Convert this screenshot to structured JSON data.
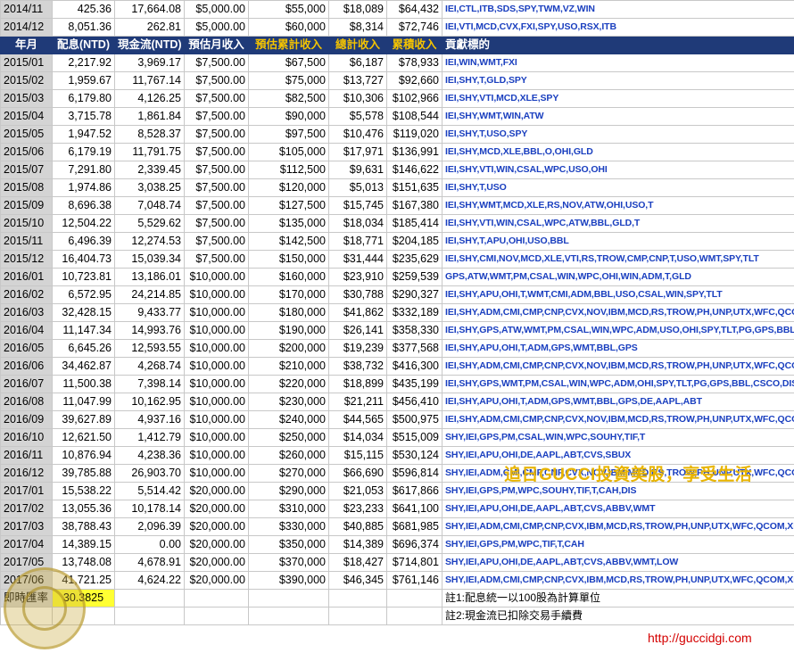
{
  "header": {
    "col_month": "年月",
    "col_dividend": "配息(NTD)",
    "col_cashflow": "現金流(NTD)",
    "col_est_monthly": "預估月收入",
    "col_est_cumulative": "預估累計收入",
    "col_total": "總計收入",
    "col_accum": "累積收入",
    "col_contrib": "貢獻標的"
  },
  "top_rows": [
    {
      "month": "2014/11",
      "dividend": "425.36",
      "cashflow": "17,664.08",
      "est_monthly": "$5,000.00",
      "est_cum": "$55,000",
      "total": "$18,089",
      "accum": "$64,432",
      "stocks": "IEI,CTL,ITB,SDS,SPY,TWM,VZ,WIN"
    },
    {
      "month": "2014/12",
      "dividend": "8,051.36",
      "cashflow": "262.81",
      "est_monthly": "$5,000.00",
      "est_cum": "$60,000",
      "total": "$8,314",
      "accum": "$72,746",
      "stocks": "IEI,VTI,MCD,CVX,FXI,SPY,USO,RSX,ITB"
    }
  ],
  "rows": [
    {
      "month": "2015/01",
      "dividend": "2,217.92",
      "cashflow": "3,969.17",
      "est_monthly": "$7,500.00",
      "est_cum": "$67,500",
      "total": "$6,187",
      "accum": "$78,933",
      "stocks": "IEI,WIN,WMT,FXI"
    },
    {
      "month": "2015/02",
      "dividend": "1,959.67",
      "cashflow": "11,767.14",
      "est_monthly": "$7,500.00",
      "est_cum": "$75,000",
      "total": "$13,727",
      "accum": "$92,660",
      "stocks": "IEI,SHY,T,GLD,SPY"
    },
    {
      "month": "2015/03",
      "dividend": "6,179.80",
      "cashflow": "4,126.25",
      "est_monthly": "$7,500.00",
      "est_cum": "$82,500",
      "total": "$10,306",
      "accum": "$102,966",
      "stocks": "IEI,SHY,VTI,MCD,XLE,SPY"
    },
    {
      "month": "2015/04",
      "dividend": "3,715.78",
      "cashflow": "1,861.84",
      "est_monthly": "$7,500.00",
      "est_cum": "$90,000",
      "total": "$5,578",
      "accum": "$108,544",
      "stocks": "IEI,SHY,WMT,WIN,ATW"
    },
    {
      "month": "2015/05",
      "dividend": "1,947.52",
      "cashflow": "8,528.37",
      "est_monthly": "$7,500.00",
      "est_cum": "$97,500",
      "total": "$10,476",
      "accum": "$119,020",
      "stocks": "IEI,SHY,T,USO,SPY"
    },
    {
      "month": "2015/06",
      "dividend": "6,179.19",
      "cashflow": "11,791.75",
      "est_monthly": "$7,500.00",
      "est_cum": "$105,000",
      "total": "$17,971",
      "accum": "$136,991",
      "stocks": "IEI,SHY,MCD,XLE,BBL,O,OHI,GLD"
    },
    {
      "month": "2015/07",
      "dividend": "7,291.80",
      "cashflow": "2,339.45",
      "est_monthly": "$7,500.00",
      "est_cum": "$112,500",
      "total": "$9,631",
      "accum": "$146,622",
      "stocks": "IEI,SHY,VTI,WIN,CSAL,WPC,USO,OHI"
    },
    {
      "month": "2015/08",
      "dividend": "1,974.86",
      "cashflow": "3,038.25",
      "est_monthly": "$7,500.00",
      "est_cum": "$120,000",
      "total": "$5,013",
      "accum": "$151,635",
      "stocks": "IEI,SHY,T,USO"
    },
    {
      "month": "2015/09",
      "dividend": "8,696.38",
      "cashflow": "7,048.74",
      "est_monthly": "$7,500.00",
      "est_cum": "$127,500",
      "total": "$15,745",
      "accum": "$167,380",
      "stocks": "IEI,SHY,WMT,MCD,XLE,RS,NOV,ATW,OHI,USO,T"
    },
    {
      "month": "2015/10",
      "dividend": "12,504.22",
      "cashflow": "5,529.62",
      "est_monthly": "$7,500.00",
      "est_cum": "$135,000",
      "total": "$18,034",
      "accum": "$185,414",
      "stocks": "IEI,SHY,VTI,WIN,CSAL,WPC,ATW,BBL,GLD,T"
    },
    {
      "month": "2015/11",
      "dividend": "6,496.39",
      "cashflow": "12,274.53",
      "est_monthly": "$7,500.00",
      "est_cum": "$142,500",
      "total": "$18,771",
      "accum": "$204,185",
      "stocks": "IEI,SHY,T,APU,OHI,USO,BBL"
    },
    {
      "month": "2015/12",
      "dividend": "16,404.73",
      "cashflow": "15,039.34",
      "est_monthly": "$7,500.00",
      "est_cum": "$150,000",
      "total": "$31,444",
      "accum": "$235,629",
      "stocks": "IEI,SHY,CMI,NOV,MCD,XLE,VTI,RS,TROW,CMP,CNP,T,USO,WMT,SPY,TLT"
    },
    {
      "month": "2016/01",
      "dividend": "10,723.81",
      "cashflow": "13,186.01",
      "est_monthly": "$10,000.00",
      "est_cum": "$160,000",
      "total": "$23,910",
      "accum": "$259,539",
      "stocks": "GPS,ATW,WMT,PM,CSAL,WIN,WPC,OHI,WIN,ADM,T,GLD"
    },
    {
      "month": "2016/02",
      "dividend": "6,572.95",
      "cashflow": "24,214.85",
      "est_monthly": "$10,000.00",
      "est_cum": "$170,000",
      "total": "$30,788",
      "accum": "$290,327",
      "stocks": "IEI,SHY,APU,OHI,T,WMT,CMI,ADM,BBL,USO,CSAL,WIN,SPY,TLT"
    },
    {
      "month": "2016/03",
      "dividend": "32,428.15",
      "cashflow": "9,433.77",
      "est_monthly": "$10,000.00",
      "est_cum": "$180,000",
      "total": "$41,862",
      "accum": "$332,189",
      "stocks": "IEI,SHY,ADM,CMI,CMP,CNP,CVX,NOV,IBM,MCD,RS,TROW,PH,UNP,UTX,WFC,QCOM"
    },
    {
      "month": "2016/04",
      "dividend": "11,147.34",
      "cashflow": "14,993.76",
      "est_monthly": "$10,000.00",
      "est_cum": "$190,000",
      "total": "$26,141",
      "accum": "$358,330",
      "stocks": "IEI,SHY,GPS,ATW,WMT,PM,CSAL,WIN,WPC,ADM,USO,OHI,SPY,TLT,PG,GPS,BBL"
    },
    {
      "month": "2016/05",
      "dividend": "6,645.26",
      "cashflow": "12,593.55",
      "est_monthly": "$10,000.00",
      "est_cum": "$200,000",
      "total": "$19,239",
      "accum": "$377,568",
      "stocks": "IEI,SHY,APU,OHI,T,ADM,GPS,WMT,BBL,GPS"
    },
    {
      "month": "2016/06",
      "dividend": "34,462.87",
      "cashflow": "4,268.74",
      "est_monthly": "$10,000.00",
      "est_cum": "$210,000",
      "total": "$38,732",
      "accum": "$416,300",
      "stocks": "IEI,SHY,ADM,CMI,CMP,CNP,CVX,NOV,IBM,MCD,RS,TROW,PH,UNP,UTX,WFC,QCOM"
    },
    {
      "month": "2016/07",
      "dividend": "11,500.38",
      "cashflow": "7,398.14",
      "est_monthly": "$10,000.00",
      "est_cum": "$220,000",
      "total": "$18,899",
      "accum": "$435,199",
      "stocks": "IEI,SHY,GPS,WMT,PM,CSAL,WIN,WPC,ADM,OHI,SPY,TLT,PG,GPS,BBL,CSCO,DIS"
    },
    {
      "month": "2016/08",
      "dividend": "11,047.99",
      "cashflow": "10,162.95",
      "est_monthly": "$10,000.00",
      "est_cum": "$230,000",
      "total": "$21,211",
      "accum": "$456,410",
      "stocks": "IEI,SHY,APU,OHI,T,ADM,GPS,WMT,BBL,GPS,DE,AAPL,ABT"
    },
    {
      "month": "2016/09",
      "dividend": "39,627.89",
      "cashflow": "4,937.16",
      "est_monthly": "$10,000.00",
      "est_cum": "$240,000",
      "total": "$44,565",
      "accum": "$500,975",
      "stocks": "IEI,SHY,ADM,CMI,CMP,CNP,CVX,NOV,IBM,MCD,RS,TROW,PH,UNP,UTX,WFC,QCOM"
    },
    {
      "month": "2016/10",
      "dividend": "12,621.50",
      "cashflow": "1,412.79",
      "est_monthly": "$10,000.00",
      "est_cum": "$250,000",
      "total": "$14,034",
      "accum": "$515,009",
      "stocks": "SHY,IEI,GPS,PM,CSAL,WIN,WPC,SOUHY,TIF,T"
    },
    {
      "month": "2016/11",
      "dividend": "10,876.94",
      "cashflow": "4,238.36",
      "est_monthly": "$10,000.00",
      "est_cum": "$260,000",
      "total": "$15,115",
      "accum": "$530,124",
      "stocks": "SHY,IEI,APU,OHI,DE,AAPL,ABT,CVS,SBUX"
    },
    {
      "month": "2016/12",
      "dividend": "39,785.88",
      "cashflow": "26,903.70",
      "est_monthly": "$10,000.00",
      "est_cum": "$270,000",
      "total": "$66,690",
      "accum": "$596,814",
      "stocks": "SHY,IEI,ADM,CMI,CMP,CNP,CVX,NOV,IBM,MCD,RS,TROW,PH,UNP,UTX,WFC,QCOM"
    },
    {
      "month": "2017/01",
      "dividend": "15,538.22",
      "cashflow": "5,514.42",
      "est_monthly": "$20,000.00",
      "est_cum": "$290,000",
      "total": "$21,053",
      "accum": "$617,866",
      "stocks": "SHY,IEI,GPS,PM,WPC,SOUHY,TIF,T,CAH,DIS"
    },
    {
      "month": "2017/02",
      "dividend": "13,055.36",
      "cashflow": "10,178.14",
      "est_monthly": "$20,000.00",
      "est_cum": "$310,000",
      "total": "$23,233",
      "accum": "$641,100",
      "stocks": "SHY,IEI,APU,OHI,DE,AAPL,ABT,CVS,ABBV,WMT"
    },
    {
      "month": "2017/03",
      "dividend": "38,788.43",
      "cashflow": "2,096.39",
      "est_monthly": "$20,000.00",
      "est_cum": "$330,000",
      "total": "$40,885",
      "accum": "$681,985",
      "stocks": "SHY,IEI,ADM,CMI,CMP,CNP,CVX,IBM,MCD,RS,TROW,PH,UNP,UTX,WFC,QCOM,XLI"
    },
    {
      "month": "2017/04",
      "dividend": "14,389.15",
      "cashflow": "0.00",
      "est_monthly": "$20,000.00",
      "est_cum": "$350,000",
      "total": "$14,389",
      "accum": "$696,374",
      "stocks": "SHY,IEI,GPS,PM,WPC,TIF,T,CAH"
    },
    {
      "month": "2017/05",
      "dividend": "13,748.08",
      "cashflow": "4,678.91",
      "est_monthly": "$20,000.00",
      "est_cum": "$370,000",
      "total": "$18,427",
      "accum": "$714,801",
      "stocks": "SHY,IEI,APU,OHI,DE,AAPL,ABT,CVS,ABBV,WMT,LOW"
    },
    {
      "month": "2017/06",
      "dividend": "41,721.25",
      "cashflow": "4,624.22",
      "est_monthly": "$20,000.00",
      "est_cum": "$390,000",
      "total": "$46,345",
      "accum": "$761,146",
      "stocks": "SHY,IEI,ADM,CMI,CMP,CNP,CVX,IBM,MCD,RS,TROW,PH,UNP,UTX,WFC,QCOM,XLI"
    }
  ],
  "footer": {
    "rate_label": "即時匯率",
    "rate_value": "30.3825",
    "note1": "註1:配息統一以100股為計算單位",
    "note2": "註2:現金流已扣除交易手續費"
  },
  "watermark": "追日GUCCI投資美股，享受生活",
  "url": "http://guccidgi.com",
  "colors": {
    "header_bg": "#1f3a78",
    "header_highlight": "#f5c400",
    "stock_text": "#1a3fbf",
    "date_bg": "#d4d4d4",
    "rate_bg": "#ffff33",
    "watermark": "#e8b400",
    "url": "#d40000"
  }
}
